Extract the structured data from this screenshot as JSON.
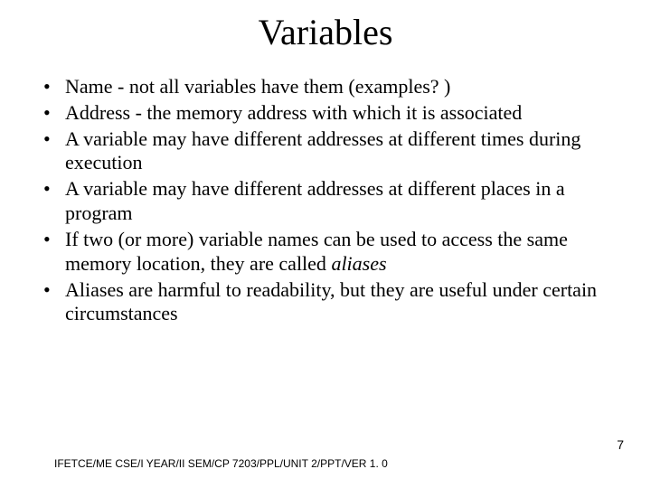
{
  "title": "Variables",
  "bullets": [
    {
      "pre": "Name - not all variables have them (examples? )",
      "em": "",
      "post": ""
    },
    {
      "pre": "Address - the memory address with which it is associated",
      "em": "",
      "post": ""
    },
    {
      "pre": "A variable may have different addresses at different times during execution",
      "em": "",
      "post": ""
    },
    {
      "pre": "A variable may have different addresses at different places in a program",
      "em": "",
      "post": ""
    },
    {
      "pre": "If two (or more) variable names can be used to access the same memory location, they are called ",
      "em": "aliases",
      "post": ""
    },
    {
      "pre": "Aliases are harmful to readability, but they are useful under certain circumstances",
      "em": "",
      "post": ""
    }
  ],
  "footer": "IFETCE/ME CSE/I YEAR/II SEM/CP 7203/PPL/UNIT 2/PPT/VER 1. 0",
  "page_number": "7"
}
